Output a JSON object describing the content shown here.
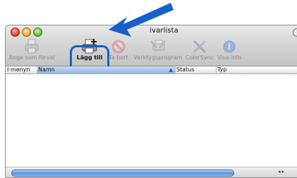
{
  "window": {
    "title": "ivarlista"
  },
  "toolbar": {
    "items": [
      {
        "label": "Ange som förval",
        "icon": "printer-default-icon",
        "enabled": false
      },
      {
        "label": "Lägg till",
        "icon": "add-printer-icon",
        "enabled": true
      },
      {
        "label": "Ta bort",
        "icon": "delete-icon",
        "enabled": false
      },
      {
        "label": "Verktygsprogram",
        "icon": "utility-icon",
        "enabled": false
      },
      {
        "label": "ColorSync",
        "icon": "colorsync-icon",
        "enabled": false
      },
      {
        "label": "Visa info",
        "icon": "info-icon",
        "enabled": false
      }
    ]
  },
  "table": {
    "columns": [
      "I menyn",
      "Namn",
      "Status",
      "Typ"
    ],
    "sorted_column": "Namn",
    "rows": []
  },
  "colors": {
    "highlight": "#1561c8",
    "callout_arrow": "#1561c8",
    "selection_header": "#8fb3e6"
  }
}
